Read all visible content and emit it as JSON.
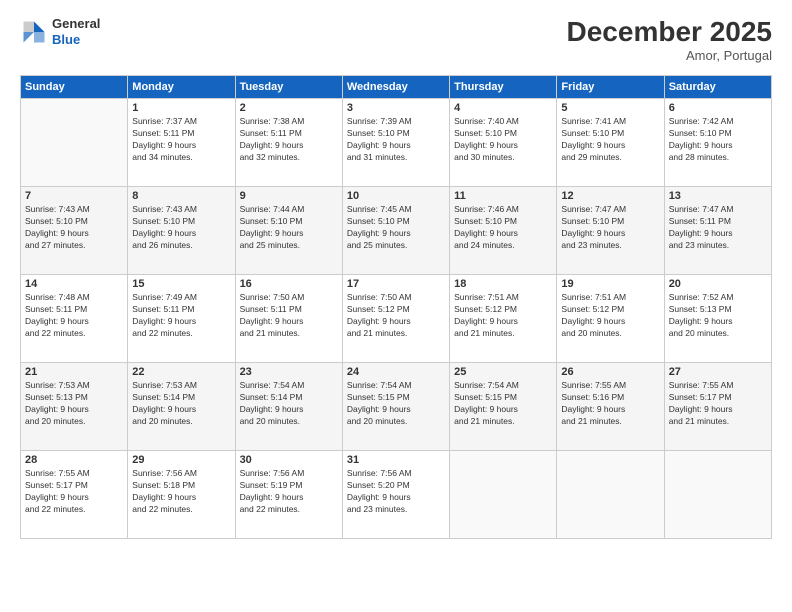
{
  "header": {
    "logo_general": "General",
    "logo_blue": "Blue",
    "month_title": "December 2025",
    "location": "Amor, Portugal"
  },
  "weekdays": [
    "Sunday",
    "Monday",
    "Tuesday",
    "Wednesday",
    "Thursday",
    "Friday",
    "Saturday"
  ],
  "weeks": [
    [
      {
        "day": "",
        "info": ""
      },
      {
        "day": "1",
        "info": "Sunrise: 7:37 AM\nSunset: 5:11 PM\nDaylight: 9 hours\nand 34 minutes."
      },
      {
        "day": "2",
        "info": "Sunrise: 7:38 AM\nSunset: 5:11 PM\nDaylight: 9 hours\nand 32 minutes."
      },
      {
        "day": "3",
        "info": "Sunrise: 7:39 AM\nSunset: 5:10 PM\nDaylight: 9 hours\nand 31 minutes."
      },
      {
        "day": "4",
        "info": "Sunrise: 7:40 AM\nSunset: 5:10 PM\nDaylight: 9 hours\nand 30 minutes."
      },
      {
        "day": "5",
        "info": "Sunrise: 7:41 AM\nSunset: 5:10 PM\nDaylight: 9 hours\nand 29 minutes."
      },
      {
        "day": "6",
        "info": "Sunrise: 7:42 AM\nSunset: 5:10 PM\nDaylight: 9 hours\nand 28 minutes."
      }
    ],
    [
      {
        "day": "7",
        "info": "Sunrise: 7:43 AM\nSunset: 5:10 PM\nDaylight: 9 hours\nand 27 minutes."
      },
      {
        "day": "8",
        "info": "Sunrise: 7:43 AM\nSunset: 5:10 PM\nDaylight: 9 hours\nand 26 minutes."
      },
      {
        "day": "9",
        "info": "Sunrise: 7:44 AM\nSunset: 5:10 PM\nDaylight: 9 hours\nand 25 minutes."
      },
      {
        "day": "10",
        "info": "Sunrise: 7:45 AM\nSunset: 5:10 PM\nDaylight: 9 hours\nand 25 minutes."
      },
      {
        "day": "11",
        "info": "Sunrise: 7:46 AM\nSunset: 5:10 PM\nDaylight: 9 hours\nand 24 minutes."
      },
      {
        "day": "12",
        "info": "Sunrise: 7:47 AM\nSunset: 5:10 PM\nDaylight: 9 hours\nand 23 minutes."
      },
      {
        "day": "13",
        "info": "Sunrise: 7:47 AM\nSunset: 5:11 PM\nDaylight: 9 hours\nand 23 minutes."
      }
    ],
    [
      {
        "day": "14",
        "info": "Sunrise: 7:48 AM\nSunset: 5:11 PM\nDaylight: 9 hours\nand 22 minutes."
      },
      {
        "day": "15",
        "info": "Sunrise: 7:49 AM\nSunset: 5:11 PM\nDaylight: 9 hours\nand 22 minutes."
      },
      {
        "day": "16",
        "info": "Sunrise: 7:50 AM\nSunset: 5:11 PM\nDaylight: 9 hours\nand 21 minutes."
      },
      {
        "day": "17",
        "info": "Sunrise: 7:50 AM\nSunset: 5:12 PM\nDaylight: 9 hours\nand 21 minutes."
      },
      {
        "day": "18",
        "info": "Sunrise: 7:51 AM\nSunset: 5:12 PM\nDaylight: 9 hours\nand 21 minutes."
      },
      {
        "day": "19",
        "info": "Sunrise: 7:51 AM\nSunset: 5:12 PM\nDaylight: 9 hours\nand 20 minutes."
      },
      {
        "day": "20",
        "info": "Sunrise: 7:52 AM\nSunset: 5:13 PM\nDaylight: 9 hours\nand 20 minutes."
      }
    ],
    [
      {
        "day": "21",
        "info": "Sunrise: 7:53 AM\nSunset: 5:13 PM\nDaylight: 9 hours\nand 20 minutes."
      },
      {
        "day": "22",
        "info": "Sunrise: 7:53 AM\nSunset: 5:14 PM\nDaylight: 9 hours\nand 20 minutes."
      },
      {
        "day": "23",
        "info": "Sunrise: 7:54 AM\nSunset: 5:14 PM\nDaylight: 9 hours\nand 20 minutes."
      },
      {
        "day": "24",
        "info": "Sunrise: 7:54 AM\nSunset: 5:15 PM\nDaylight: 9 hours\nand 20 minutes."
      },
      {
        "day": "25",
        "info": "Sunrise: 7:54 AM\nSunset: 5:15 PM\nDaylight: 9 hours\nand 21 minutes."
      },
      {
        "day": "26",
        "info": "Sunrise: 7:55 AM\nSunset: 5:16 PM\nDaylight: 9 hours\nand 21 minutes."
      },
      {
        "day": "27",
        "info": "Sunrise: 7:55 AM\nSunset: 5:17 PM\nDaylight: 9 hours\nand 21 minutes."
      }
    ],
    [
      {
        "day": "28",
        "info": "Sunrise: 7:55 AM\nSunset: 5:17 PM\nDaylight: 9 hours\nand 22 minutes."
      },
      {
        "day": "29",
        "info": "Sunrise: 7:56 AM\nSunset: 5:18 PM\nDaylight: 9 hours\nand 22 minutes."
      },
      {
        "day": "30",
        "info": "Sunrise: 7:56 AM\nSunset: 5:19 PM\nDaylight: 9 hours\nand 22 minutes."
      },
      {
        "day": "31",
        "info": "Sunrise: 7:56 AM\nSunset: 5:20 PM\nDaylight: 9 hours\nand 23 minutes."
      },
      {
        "day": "",
        "info": ""
      },
      {
        "day": "",
        "info": ""
      },
      {
        "day": "",
        "info": ""
      }
    ]
  ]
}
